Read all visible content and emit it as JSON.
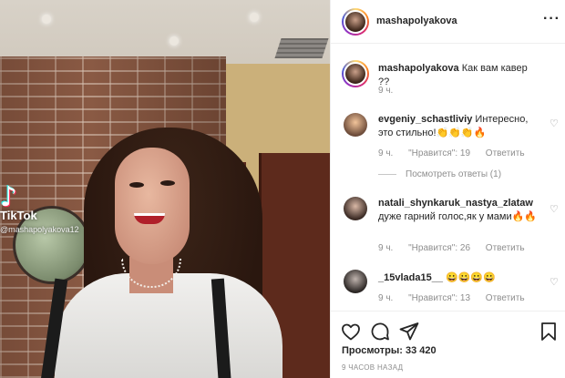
{
  "video": {
    "watermark_brand": "TikTok",
    "watermark_user": "@mashapolyakova12",
    "watermark_logo_glyph": "♪"
  },
  "post": {
    "author": "mashapolyakova",
    "more_glyph": "···",
    "caption": {
      "username": "mashapolyakova",
      "text": "Как вам кавер ??",
      "time": "9 ч."
    },
    "comments": [
      {
        "username": "evgeniy_schastliviy",
        "text": "Интересно, это стильно!👏👏👏🔥",
        "time": "9 ч.",
        "likes": "\"Нравится\": 19",
        "reply": "Ответить",
        "heart_glyph": "♡",
        "view_replies": "Посмотреть ответы (1)"
      },
      {
        "username": "natali_shynkaruk_nastya_zlataw",
        "text": "дуже гарний голос,як у мами🔥🔥",
        "time": "9 ч.",
        "likes": "\"Нравится\": 26",
        "reply": "Ответить",
        "heart_glyph": "♡"
      },
      {
        "username": "_15vlada15__",
        "text": "😀😀😀😀",
        "time": "9 ч.",
        "likes": "\"Нравится\": 13",
        "reply": "Ответить",
        "heart_glyph": "♡"
      }
    ],
    "views_label": "Просмотры: 33 420",
    "posted_ago": "9 ЧАСОВ НАЗАД"
  },
  "colors": {
    "text": "#262626",
    "secondary": "#8e8e8e",
    "border": "#efefef"
  }
}
